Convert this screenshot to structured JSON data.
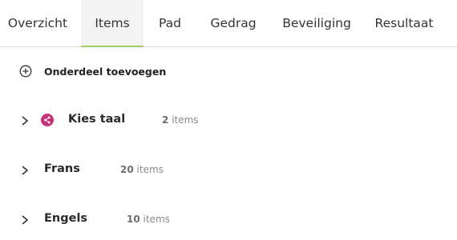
{
  "tabs": [
    {
      "label": "Overzicht",
      "active": false
    },
    {
      "label": "Items",
      "active": true
    },
    {
      "label": "Pad",
      "active": false
    },
    {
      "label": "Gedrag",
      "active": false
    },
    {
      "label": "Beveiliging",
      "active": false
    },
    {
      "label": "Resultaat",
      "active": false
    }
  ],
  "add_item": {
    "label": "Onderdeel toevoegen",
    "icon": "plus-circle-icon"
  },
  "items": [
    {
      "title": "Kies taal",
      "count": "2",
      "count_suffix": "items",
      "icon": "share-icon",
      "icon_color": "#c8327a"
    },
    {
      "title": "Frans",
      "count": "20",
      "count_suffix": "items"
    },
    {
      "title": "Engels",
      "count": "10",
      "count_suffix": "items"
    }
  ],
  "colors": {
    "active_tab_underline": "#9fcd6b",
    "active_tab_bg": "#f3f3f3"
  }
}
